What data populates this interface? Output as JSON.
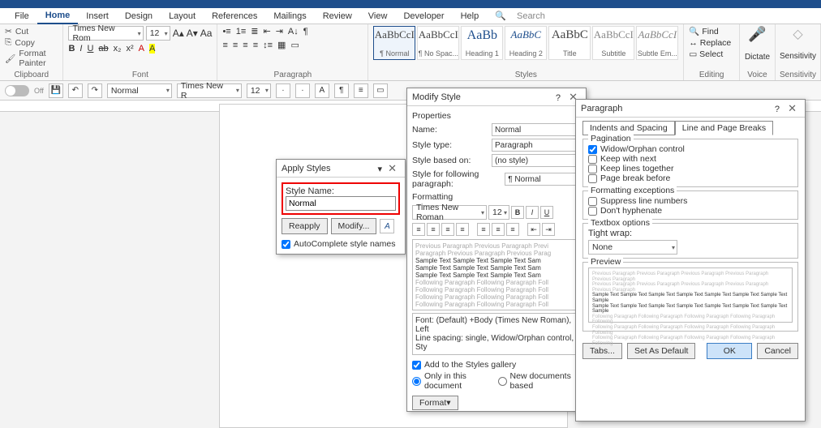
{
  "menubar": [
    "File",
    "Home",
    "Insert",
    "Design",
    "Layout",
    "References",
    "Mailings",
    "Review",
    "View",
    "Developer",
    "Help"
  ],
  "menubar_active": 1,
  "search_placeholder": "Search",
  "clipboard": {
    "cut": "Cut",
    "copy": "Copy",
    "format_painter": "Format Painter",
    "label": "Clipboard"
  },
  "font": {
    "name": "Times New Rom",
    "size": "12",
    "label": "Font",
    "buttons": [
      "B",
      "I",
      "U",
      "ab",
      "x₂",
      "x²",
      "A",
      "A"
    ]
  },
  "paragraph_group": {
    "label": "Paragraph"
  },
  "styles": {
    "label": "Styles",
    "cards": [
      {
        "sample": "AaBbCcI",
        "name": "¶ Normal",
        "sel": true
      },
      {
        "sample": "AaBbCcI",
        "name": "¶ No Spac..."
      },
      {
        "sample": "AaBb",
        "name": "Heading 1"
      },
      {
        "sample": "AaBbC",
        "name": "Heading 2"
      },
      {
        "sample": "AaBbC",
        "name": "Title"
      },
      {
        "sample": "AaBbCcI",
        "name": "Subtitle"
      },
      {
        "sample": "AaBbCcI",
        "name": "Subtle Em..."
      }
    ]
  },
  "editing": {
    "find": "Find",
    "replace": "Replace",
    "select": "Select",
    "label": "Editing"
  },
  "voice_label": "Voice",
  "dictate": "Dictate",
  "sensitivity_label": "Sensitivity",
  "sensitivity": "Sensitivity",
  "secbar": {
    "style_combo": "Normal",
    "font_combo": "Times New R",
    "size": "12"
  },
  "apply_styles": {
    "title": "Apply Styles",
    "style_name_label": "Style Name:",
    "style_name": "Normal",
    "reapply": "Reapply",
    "modify": "Modify...",
    "autocomplete": "AutoComplete style names"
  },
  "modify_style": {
    "title": "Modify Style",
    "properties": "Properties",
    "name_label": "Name:",
    "name": "Normal",
    "type_label": "Style type:",
    "type": "Paragraph",
    "based_label": "Style based on:",
    "based": "(no style)",
    "following_label": "Style for following paragraph:",
    "following": "¶ Normal",
    "formatting": "Formatting",
    "font_name": "Times New Roman",
    "font_size": "12",
    "preview_sample": "Sample Text Sample Text Sample Text Sam",
    "desc": "Font: (Default) +Body (Times New Roman), Left\nLine spacing:  single, Widow/Orphan control, Sty",
    "add_gallery": "Add to the Styles gallery",
    "only_doc": "Only in this document",
    "new_docs": "New documents based",
    "format_btn": "Format"
  },
  "paragraph_dlg": {
    "title": "Paragraph",
    "tab1": "Indents and Spacing",
    "tab2": "Line and Page Breaks",
    "pagination": "Pagination",
    "widow": "Widow/Orphan control",
    "keep_next": "Keep with next",
    "keep_lines": "Keep lines together",
    "page_break": "Page break before",
    "fmt_exc": "Formatting exceptions",
    "suppress": "Suppress line numbers",
    "dont_hyph": "Don't hyphenate",
    "textbox": "Textbox options",
    "tight_wrap": "Tight wrap:",
    "tight_val": "None",
    "preview": "Preview",
    "tabs_btn": "Tabs...",
    "set_default": "Set As Default",
    "ok": "OK",
    "cancel": "Cancel"
  }
}
